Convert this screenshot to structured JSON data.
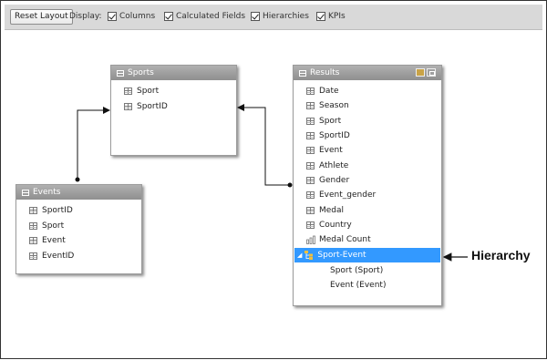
{
  "toolbar": {
    "reset_label": "Reset Layout",
    "display_label": "Display:",
    "options": [
      {
        "label": "Columns",
        "checked": true
      },
      {
        "label": "Calculated Fields",
        "checked": true
      },
      {
        "label": "Hierarchies",
        "checked": true
      },
      {
        "label": "KPIs",
        "checked": true
      }
    ]
  },
  "tables": {
    "sports": {
      "title": "Sports",
      "columns": [
        "Sport",
        "SportID"
      ]
    },
    "events": {
      "title": "Events",
      "columns": [
        "SportID",
        "Sport",
        "Event",
        "EventID"
      ]
    },
    "results": {
      "title": "Results",
      "columns": [
        "Date",
        "Season",
        "Sport",
        "SportID",
        "Event",
        "Athlete",
        "Gender",
        "Event_gender",
        "Medal",
        "Country"
      ],
      "kpi_field": "Medal Count",
      "hierarchy": {
        "name": "Sport-Event",
        "levels": [
          "Sport (Sport)",
          "Event (Event)"
        ]
      }
    }
  },
  "annotation": {
    "label": "Hierarchy"
  },
  "colors": {
    "header_gray": "#999999",
    "selection_blue": "#3399ff",
    "toolbar_bg": "#d9d9d9"
  }
}
